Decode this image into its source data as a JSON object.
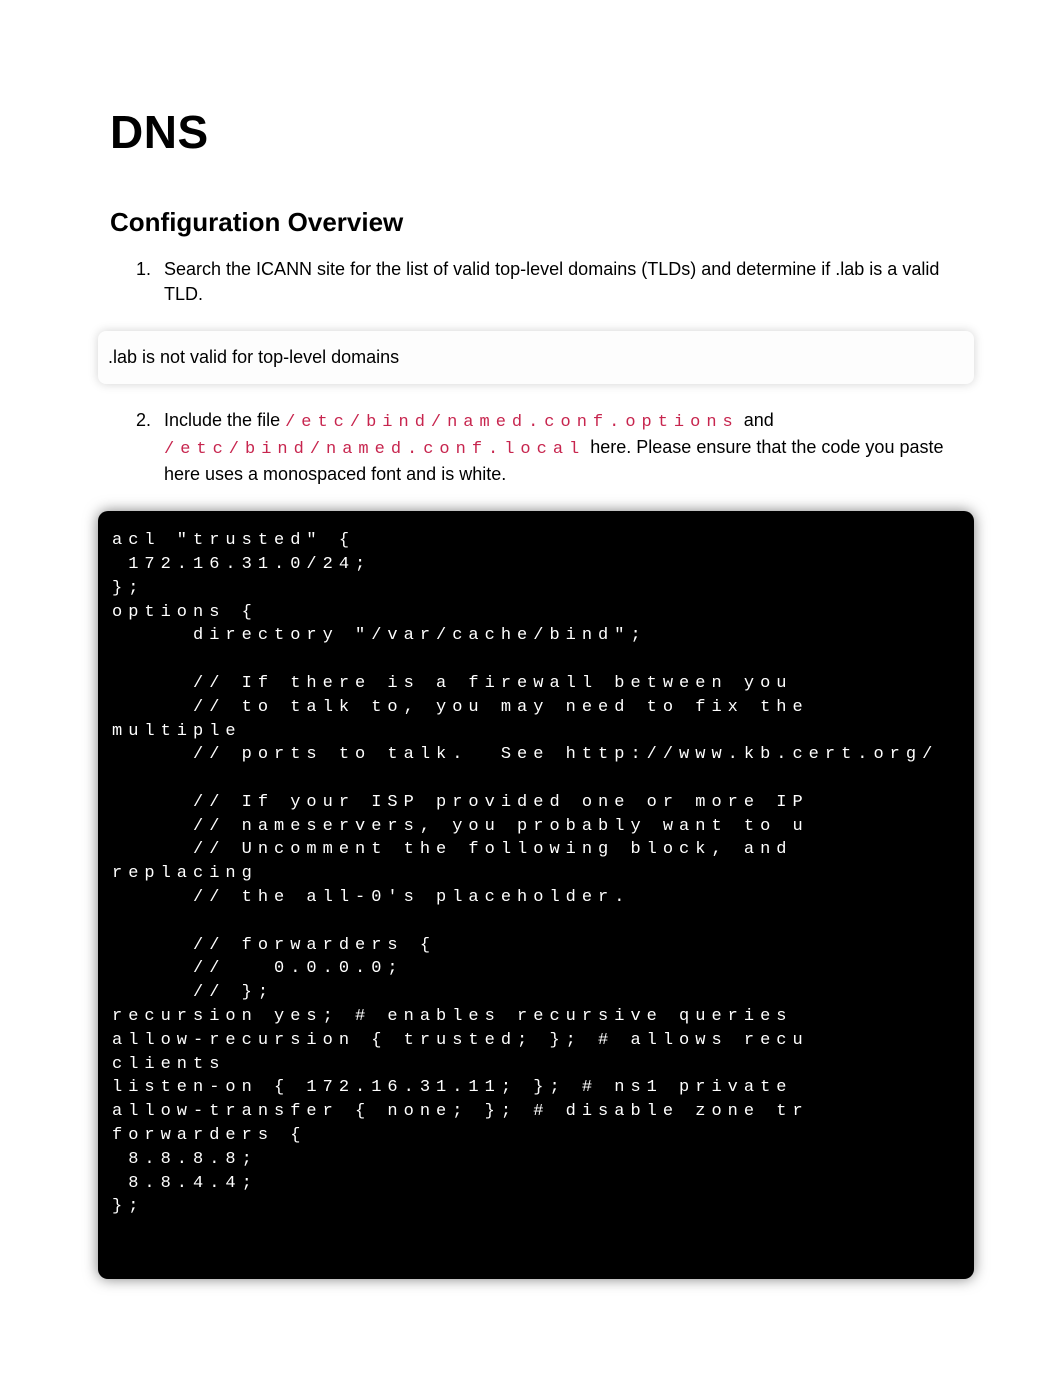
{
  "title": "DNS",
  "section_heading": "Configuration Overview",
  "list": {
    "item1": "Search the ICANN site for the list of valid top-level domains (TLDs) and determine if .lab is a valid TLD.",
    "item2_prefix": "Include the file ",
    "item2_code1": "/etc/bind/named.conf.options",
    "item2_mid1": " and ",
    "item2_code2": "/etc/bind/named.conf.local",
    "item2_rest": " here. Please ensure that the code you paste here uses a monospaced font and is white."
  },
  "callout": ".lab is not valid for top-level domains",
  "code": "acl \"trusted\" {\n 172.16.31.0/24;\n};\noptions {\n     directory \"/var/cache/bind\";\n\n     // If there is a firewall between you\n     // to talk to, you may need to fix the\nmultiple\n     // ports to talk.  See http://www.kb.cert.org/\n\n     // If your ISP provided one or more IP\n     // nameservers, you probably want to u\n     // Uncomment the following block, and\nreplacing\n     // the all-0's placeholder.\n\n     // forwarders {\n     //   0.0.0.0;\n     // };\nrecursion yes; # enables recursive queries\nallow-recursion { trusted; }; # allows recu\nclients\nlisten-on { 172.16.31.11; }; # ns1 private\nallow-transfer { none; }; # disable zone tr\nforwarders {\n 8.8.8.8;\n 8.8.4.4;\n};"
}
